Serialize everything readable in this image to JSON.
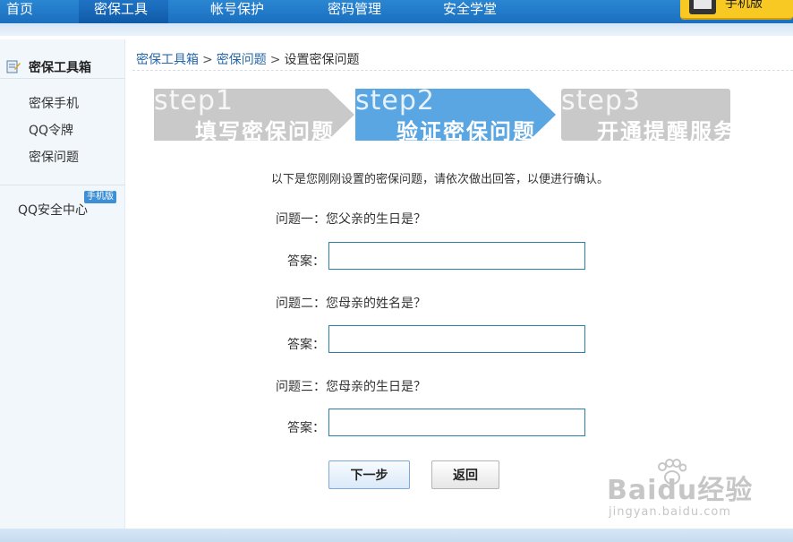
{
  "nav": {
    "items": [
      {
        "label": "首页"
      },
      {
        "label": "密保工具"
      },
      {
        "label": "帐号保护"
      },
      {
        "label": "密码管理"
      },
      {
        "label": "安全学堂"
      }
    ],
    "badge_text": "手机版"
  },
  "sidebar": {
    "title": "密保工具箱",
    "items": [
      {
        "label": "密保手机"
      },
      {
        "label": "QQ令牌"
      },
      {
        "label": "密保问题"
      }
    ],
    "qq_security": "QQ安全中心",
    "mobile_tag": "手机版"
  },
  "breadcrumb": {
    "items": [
      "密保工具箱",
      "密保问题",
      "设置密保问题"
    ],
    "separator": ">"
  },
  "steps": [
    {
      "num": "step1",
      "label": "填写密保问题",
      "color": "#c9c9c9"
    },
    {
      "num": "step2",
      "label": "验证密保问题",
      "color": "#5aa6e3"
    },
    {
      "num": "step3",
      "label": "开通提醒服务",
      "color": "#c9c9c9"
    }
  ],
  "form": {
    "intro": "以下是您刚刚设置的密保问题，请依次做出回答，以便进行确认。",
    "questions": [
      {
        "label": "问题一：您父亲的生日是？",
        "answer_label": "答案：",
        "value": ""
      },
      {
        "label": "问题二：您母亲的姓名是？",
        "answer_label": "答案：",
        "value": ""
      },
      {
        "label": "问题三：您母亲的生日是？",
        "answer_label": "答案：",
        "value": ""
      }
    ],
    "next_label": "下一步",
    "back_label": "返回"
  },
  "watermark": {
    "logo": "Baidu经验",
    "url": "jingyan.baidu.com"
  }
}
